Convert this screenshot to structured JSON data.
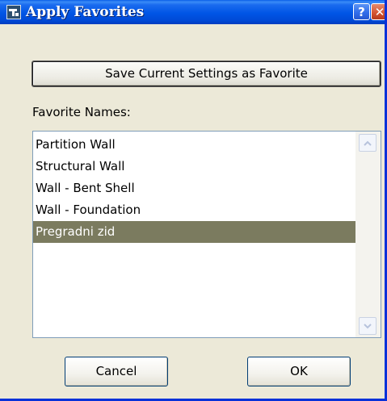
{
  "window": {
    "title": "Apply Favorites",
    "help_label": "?",
    "close_label": "✕"
  },
  "save_button_label": "Save Current Settings as Favorite",
  "favorites_label": "Favorite Names:",
  "favorites": [
    {
      "label": "Partition Wall",
      "selected": false
    },
    {
      "label": "Structural Wall",
      "selected": false
    },
    {
      "label": "Wall - Bent Shell",
      "selected": false
    },
    {
      "label": "Wall - Foundation",
      "selected": false
    },
    {
      "label": "Pregradni zid",
      "selected": true
    }
  ],
  "buttons": {
    "cancel": "Cancel",
    "ok": "OK"
  },
  "icons": {
    "app": "favorites-app-icon",
    "scroll_up": "chevron-up-icon",
    "scroll_down": "chevron-down-icon"
  },
  "colors": {
    "titlebar": "#0055e5",
    "selection": "#7b7b5f",
    "dialog_bg": "#ece9d8",
    "close": "#d4532f"
  }
}
